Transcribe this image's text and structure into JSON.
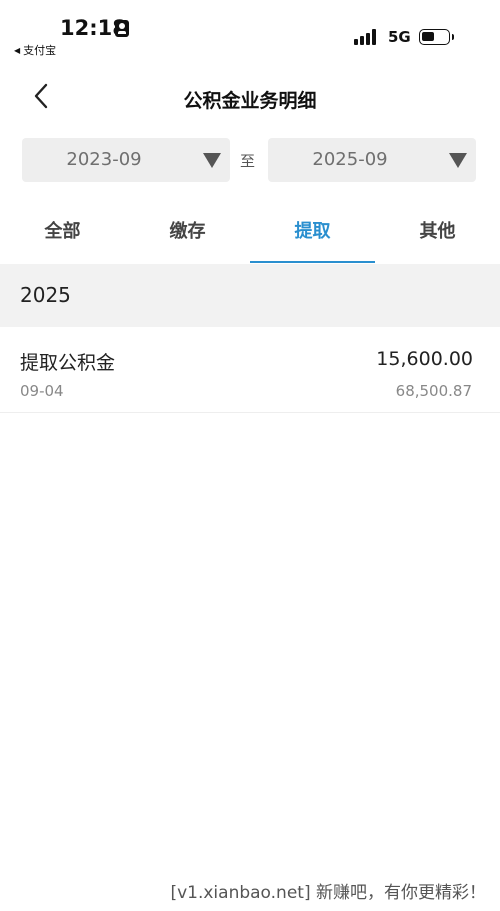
{
  "status_bar": {
    "time": "12:18",
    "back_app": "支付宝",
    "network": "5G"
  },
  "nav": {
    "title": "公积金业务明细"
  },
  "date_filter": {
    "start": "2023-09",
    "separator": "至",
    "end": "2025-09"
  },
  "tabs": [
    {
      "label": "全部",
      "active": false
    },
    {
      "label": "缴存",
      "active": false
    },
    {
      "label": "提取",
      "active": true
    },
    {
      "label": "其他",
      "active": false
    }
  ],
  "records": {
    "year": "2025",
    "items": [
      {
        "title": "提取公积金",
        "date": "09-04",
        "amount": "15,600.00",
        "balance": "68,500.87"
      }
    ]
  },
  "watermark": "[v1.xianbao.net] 新赚吧，有你更精彩！",
  "colors": {
    "accent": "#2a8fcf",
    "section_bg": "#f2f2f2",
    "select_bg": "#eeeeee"
  }
}
